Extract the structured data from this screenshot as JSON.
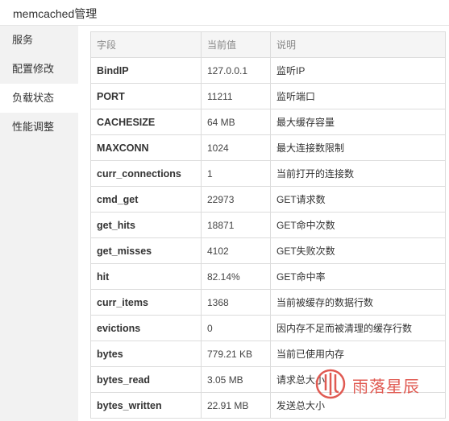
{
  "header": {
    "title": "memcached管理"
  },
  "sidebar": {
    "items": [
      {
        "label": "服务",
        "active": false
      },
      {
        "label": "配置修改",
        "active": false
      },
      {
        "label": "负载状态",
        "active": true
      },
      {
        "label": "性能调整",
        "active": false
      }
    ]
  },
  "table": {
    "columns": [
      "字段",
      "当前值",
      "说明"
    ],
    "rows": [
      {
        "key": "BindIP",
        "value": "127.0.0.1",
        "desc": "监听IP"
      },
      {
        "key": "PORT",
        "value": "11211",
        "desc": "监听端口"
      },
      {
        "key": "CACHESIZE",
        "value": "64 MB",
        "desc": "最大缓存容量"
      },
      {
        "key": "MAXCONN",
        "value": "1024",
        "desc": "最大连接数限制"
      },
      {
        "key": "curr_connections",
        "value": "1",
        "desc": "当前打开的连接数"
      },
      {
        "key": "cmd_get",
        "value": "22973",
        "desc": "GET请求数"
      },
      {
        "key": "get_hits",
        "value": "18871",
        "desc": "GET命中次数"
      },
      {
        "key": "get_misses",
        "value": "4102",
        "desc": "GET失败次数"
      },
      {
        "key": "hit",
        "value": "82.14%",
        "desc": "GET命中率"
      },
      {
        "key": "curr_items",
        "value": "1368",
        "desc": "当前被缓存的数据行数"
      },
      {
        "key": "evictions",
        "value": "0",
        "desc": "因内存不足而被清理的缓存行数"
      },
      {
        "key": "bytes",
        "value": "779.21 KB",
        "desc": "当前已使用内存"
      },
      {
        "key": "bytes_read",
        "value": "3.05 MB",
        "desc": "请求总大小"
      },
      {
        "key": "bytes_written",
        "value": "22.91 MB",
        "desc": "发送总大小"
      }
    ]
  },
  "watermark": {
    "text": "雨落星辰",
    "color": "#e05a52"
  }
}
